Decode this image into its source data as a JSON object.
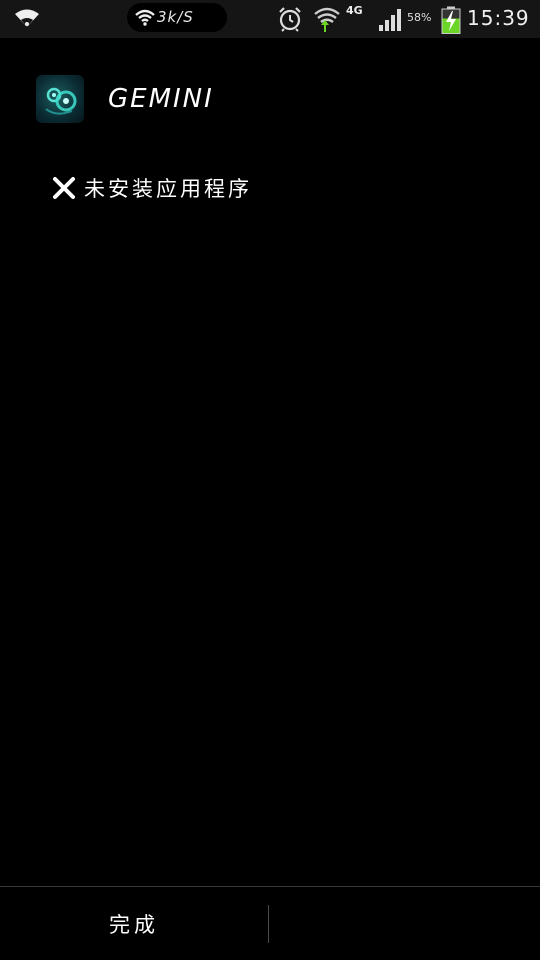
{
  "status_bar": {
    "net_speed": "3k/S",
    "network_type": "4G",
    "battery_percent": "58%",
    "time": "15:39",
    "icons": [
      "wifi-icon",
      "wifi-icon",
      "alarm-clock-icon",
      "wifi-data-icon",
      "signal-icon",
      "battery-charging-icon"
    ]
  },
  "dialog": {
    "app_name": "GEMINI",
    "app_icon": "gemini-app-icon",
    "status_icon": "close-x-icon",
    "status_message": "未安装应用程序"
  },
  "footer": {
    "done_label": "完成"
  },
  "colors": {
    "background": "#000000",
    "status_bar_bg": "#151515",
    "text": "#ffffff",
    "accent_teal": "#3fe0d0",
    "battery_green": "#6cd626"
  }
}
